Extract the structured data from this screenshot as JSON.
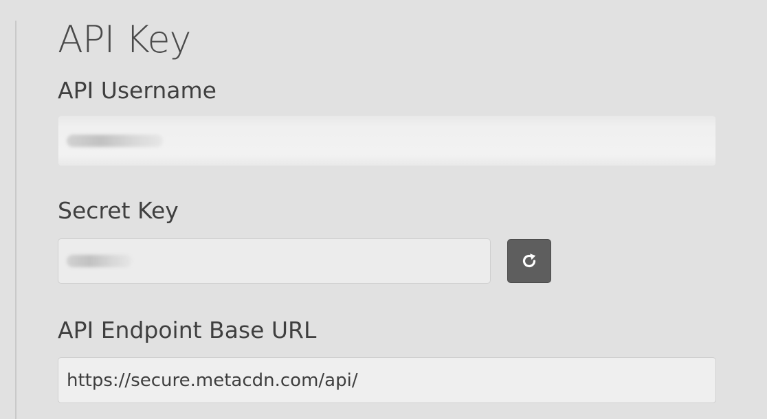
{
  "section": {
    "title": "API Key"
  },
  "fields": {
    "username": {
      "label": "API Username",
      "value": ""
    },
    "secret_key": {
      "label": "Secret Key",
      "value": ""
    },
    "endpoint": {
      "label": "API Endpoint Base URL",
      "value": "https://secure.metacdn.com/api/"
    }
  },
  "icons": {
    "refresh": "refresh-icon"
  },
  "colors": {
    "background": "#e1e1e1",
    "field_background": "#f0f0f0",
    "button_background": "#5e5e5e",
    "text": "#3f3f3f"
  }
}
